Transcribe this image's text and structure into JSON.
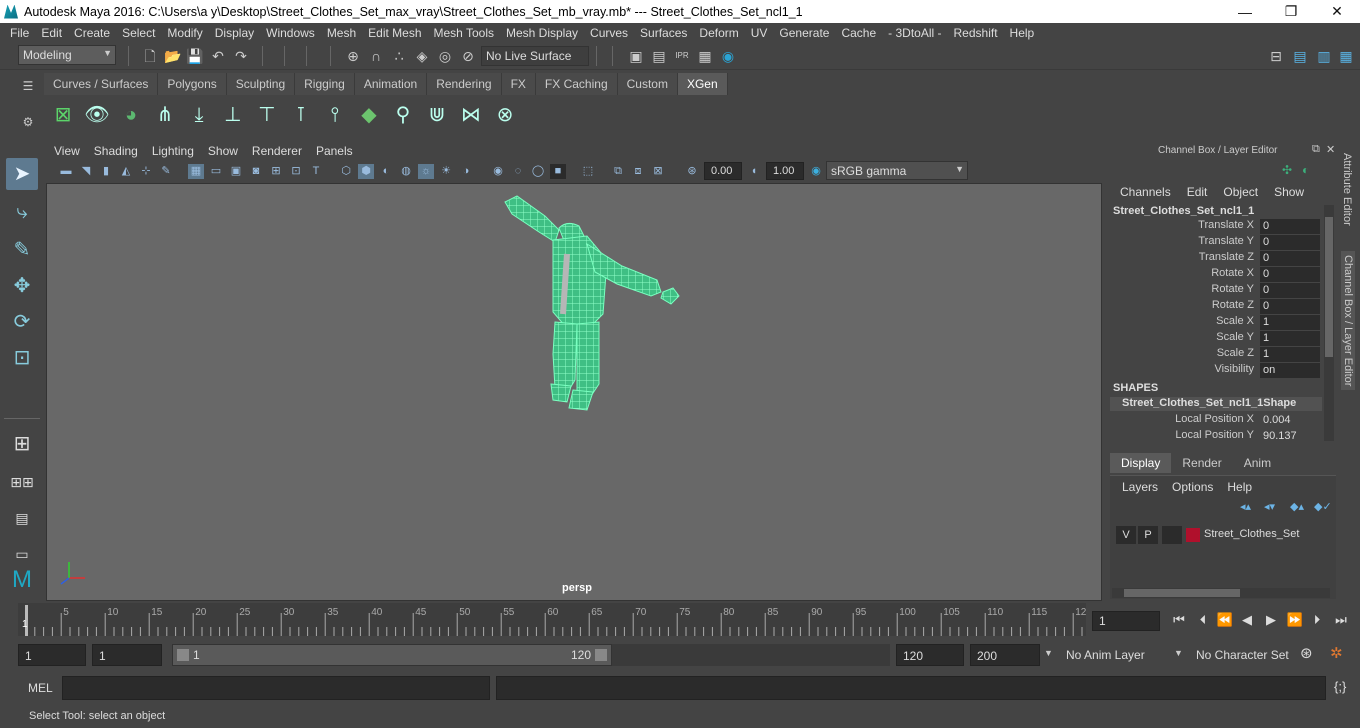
{
  "window": {
    "title": "Autodesk Maya 2016: C:\\Users\\a y\\Desktop\\Street_Clothes_Set_max_vray\\Street_Clothes_Set_mb_vray.mb*   ---   Street_Clothes_Set_ncl1_1",
    "minimize": "—",
    "maximize": "❐",
    "close": "✕"
  },
  "menubar": {
    "items": [
      "File",
      "Edit",
      "Create",
      "Select",
      "Modify",
      "Display",
      "Windows",
      "Mesh",
      "Edit Mesh",
      "Mesh Tools",
      "Mesh Display",
      "Curves",
      "Surfaces",
      "Deform",
      "UV",
      "Generate",
      "Cache",
      "- 3DtoAll -",
      "Redshift",
      "Help"
    ]
  },
  "statusline": {
    "mode": "Modeling",
    "live_surface": "No Live Surface"
  },
  "shelf": {
    "tabs": [
      "Curves / Surfaces",
      "Polygons",
      "Sculpting",
      "Rigging",
      "Animation",
      "Rendering",
      "FX",
      "FX Caching",
      "Custom",
      "XGen"
    ],
    "active_tab": "XGen"
  },
  "panel": {
    "menus": [
      "View",
      "Shading",
      "Lighting",
      "Show",
      "Renderer",
      "Panels"
    ],
    "exposure": "0.00",
    "gamma": "1.00",
    "color_space": "sRGB gamma",
    "camera": "persp"
  },
  "channel_box": {
    "header": "Channel Box / Layer Editor",
    "menus": [
      "Channels",
      "Edit",
      "Object",
      "Show"
    ],
    "object_name": "Street_Clothes_Set_ncl1_1",
    "attributes": [
      {
        "label": "Translate X",
        "value": "0"
      },
      {
        "label": "Translate Y",
        "value": "0"
      },
      {
        "label": "Translate Z",
        "value": "0"
      },
      {
        "label": "Rotate X",
        "value": "0"
      },
      {
        "label": "Rotate Y",
        "value": "0"
      },
      {
        "label": "Rotate Z",
        "value": "0"
      },
      {
        "label": "Scale X",
        "value": "1"
      },
      {
        "label": "Scale Y",
        "value": "1"
      },
      {
        "label": "Scale Z",
        "value": "1"
      },
      {
        "label": "Visibility",
        "value": "on"
      }
    ],
    "shapes_header": "SHAPES",
    "shape_name": "Street_Clothes_Set_ncl1_1Shape",
    "shape_attributes": [
      {
        "label": "Local Position X",
        "value": "0.004"
      },
      {
        "label": "Local Position Y",
        "value": "90.137"
      }
    ]
  },
  "layer_editor": {
    "tabs": [
      "Display",
      "Render",
      "Anim"
    ],
    "active_tab": "Display",
    "menus": [
      "Layers",
      "Options",
      "Help"
    ],
    "layer": {
      "v": "V",
      "p": "P",
      "name": "Street_Clothes_Set",
      "color": "#b0102c"
    }
  },
  "side_tabs": [
    "Attribute Editor",
    "Channel Box / Layer Editor"
  ],
  "timeline": {
    "ticks": [
      "5",
      "10",
      "15",
      "20",
      "25",
      "30",
      "35",
      "40",
      "45",
      "50",
      "55",
      "60",
      "65",
      "70",
      "75",
      "80",
      "85",
      "90",
      "95",
      "100",
      "105",
      "110",
      "115",
      "12"
    ],
    "start_marker": "1",
    "current_frame": "1"
  },
  "range": {
    "start": "1",
    "playback_start": "1",
    "slider_start": "1",
    "slider_end": "120",
    "playback_end": "120",
    "end": "200",
    "anim_layer": "No Anim Layer",
    "character_set": "No Character Set"
  },
  "command_line": {
    "lang": "MEL"
  },
  "help_line": "Select Tool: select an object",
  "colors": {
    "wireframe": "#5cf0a8",
    "viewport_bg": "#686868"
  }
}
